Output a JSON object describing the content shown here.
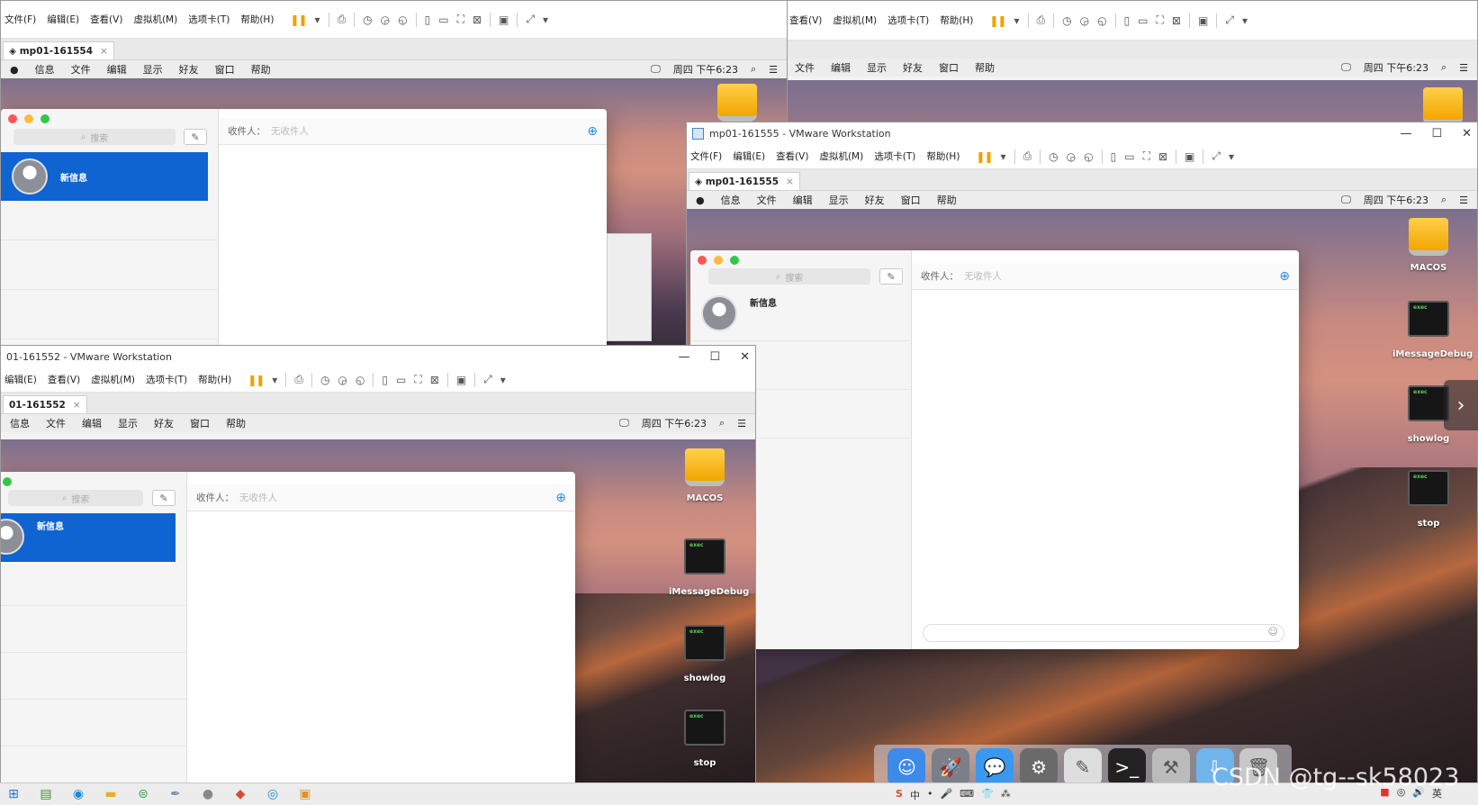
{
  "menu_common": {
    "file": "文件(F)",
    "edit": "编辑(E)",
    "view": "查看(V)",
    "vm": "虚拟机(M)",
    "tabs": "选项卡(T)",
    "help": "帮助(H)"
  },
  "mac_menu": {
    "apple": "",
    "items": [
      "信息",
      "文件",
      "编辑",
      "显示",
      "好友",
      "窗口",
      "帮助"
    ],
    "clock": "周四 下午6:23"
  },
  "win1": {
    "tab": "mp01-161554"
  },
  "win2": {
    "menu_view": "查看(V)"
  },
  "win3": {
    "title": "mp01-161555 - VMware Workstation",
    "tab": "mp01-161555"
  },
  "win4": {
    "title": "01-161552 - VMware Workstation",
    "tab": "01-161552"
  },
  "messages": {
    "search_placeholder": "搜索",
    "recipient_label": "收件人：",
    "recipient_placeholder": "无收件人",
    "new_message": "新信息"
  },
  "desktop_icons": {
    "drive": "MACOS",
    "debug": "iMessageDebug",
    "showlog": "showlog",
    "stop": "stop",
    "exec_tag": "exec"
  },
  "watermark": "CSDN @tg--sk58023",
  "colors": {
    "selection_blue": "#0f64d2",
    "accent_orange": "#f0a000"
  }
}
